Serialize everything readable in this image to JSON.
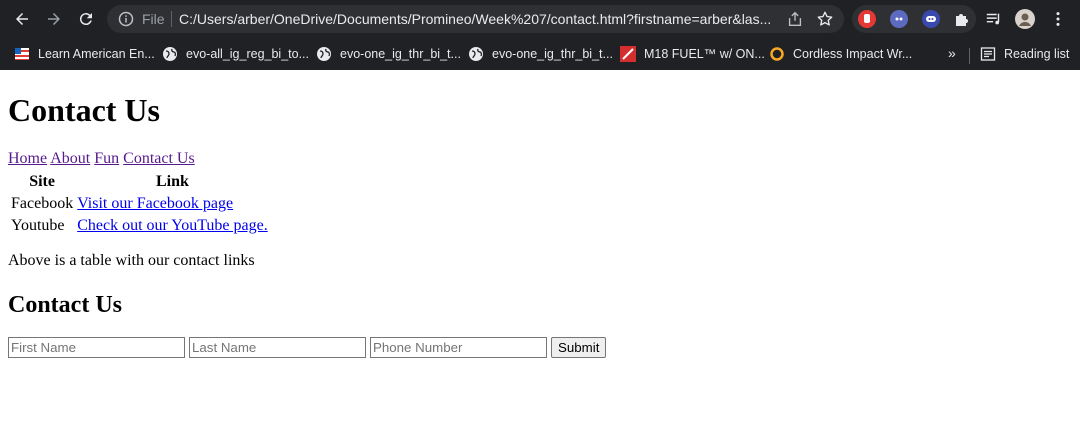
{
  "browser": {
    "file_label": "File",
    "url": "C:/Users/arber/OneDrive/Documents/Promineo/Week%207/contact.html?firstname=arber&las...",
    "bookmarks": [
      {
        "label": "Learn American En...",
        "icon": "flag-icon"
      },
      {
        "label": "evo-all_ig_reg_bi_to...",
        "icon": "globe-icon"
      },
      {
        "label": "evo-one_ig_thr_bi_t...",
        "icon": "globe-icon"
      },
      {
        "label": "evo-one_ig_thr_bi_t...",
        "icon": "globe-icon"
      },
      {
        "label": "M18 FUEL™ w/ ON...",
        "icon": "milwaukee-icon"
      },
      {
        "label": "Cordless Impact Wr...",
        "icon": "ring-icon"
      }
    ],
    "more_label": "»",
    "reading_list_label": "Reading list"
  },
  "page": {
    "title": "Contact Us",
    "nav": [
      "Home",
      "About",
      "Fun",
      "Contact Us"
    ],
    "table": {
      "headers": [
        "Site",
        "Link"
      ],
      "rows": [
        {
          "site": "Facebook",
          "link": "Visit our Facebook page"
        },
        {
          "site": "Youtube",
          "link": "Check out our YouTube page."
        }
      ]
    },
    "caption": "Above is a table with our contact links",
    "form_heading": "Contact Us",
    "form": {
      "first_name_placeholder": "First Name",
      "last_name_placeholder": "Last Name",
      "phone_placeholder": "Phone Number",
      "submit_label": "Submit"
    }
  }
}
